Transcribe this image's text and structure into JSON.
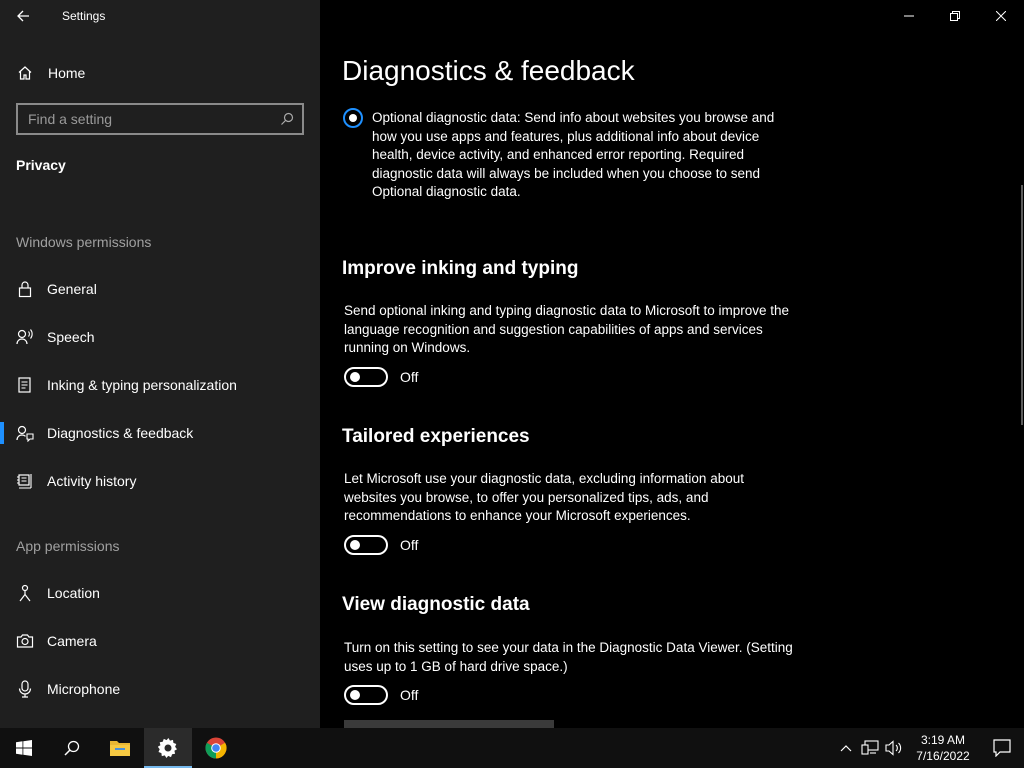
{
  "window": {
    "title": "Settings"
  },
  "sidebar": {
    "home_label": "Home",
    "search_placeholder": "Find a setting",
    "section_title": "Privacy",
    "group_windows": "Windows permissions",
    "windows_items": [
      {
        "label": "General",
        "icon": "lock-icon"
      },
      {
        "label": "Speech",
        "icon": "speech-icon"
      },
      {
        "label": "Inking & typing personalization",
        "icon": "inking-icon"
      },
      {
        "label": "Diagnostics & feedback",
        "icon": "feedback-icon",
        "active": true
      },
      {
        "label": "Activity history",
        "icon": "activity-icon"
      }
    ],
    "group_app": "App permissions",
    "app_items": [
      {
        "label": "Location",
        "icon": "location-icon"
      },
      {
        "label": "Camera",
        "icon": "camera-icon"
      },
      {
        "label": "Microphone",
        "icon": "microphone-icon"
      }
    ]
  },
  "main": {
    "title": "Diagnostics & feedback",
    "optional_radio_text": "Optional diagnostic data: Send info about websites you browse and how you use apps and features, plus additional info about device health, device activity, and enhanced error reporting. Required diagnostic data will always be included when you choose to send Optional diagnostic data.",
    "sections": [
      {
        "heading": "Improve inking and typing",
        "description": "Send optional inking and typing diagnostic data to Microsoft to improve the language recognition and suggestion capabilities of apps and services running on Windows.",
        "toggle_state": "Off"
      },
      {
        "heading": "Tailored experiences",
        "description": "Let Microsoft use your diagnostic data, excluding information about websites you browse, to offer you personalized tips, ads, and recommendations to enhance your Microsoft experiences.",
        "toggle_state": "Off"
      },
      {
        "heading": "View diagnostic data",
        "description": "Turn on this setting to see your data in the Diagnostic Data Viewer. (Setting uses up to 1 GB of hard drive space.)",
        "toggle_state": "Off"
      }
    ]
  },
  "taskbar": {
    "time": "3:19 AM",
    "date": "7/16/2022"
  },
  "colors": {
    "accent": "#1e90ff",
    "sidebar_bg": "#1f1f1f",
    "main_bg": "#000000",
    "taskbar_bg": "#101010"
  }
}
